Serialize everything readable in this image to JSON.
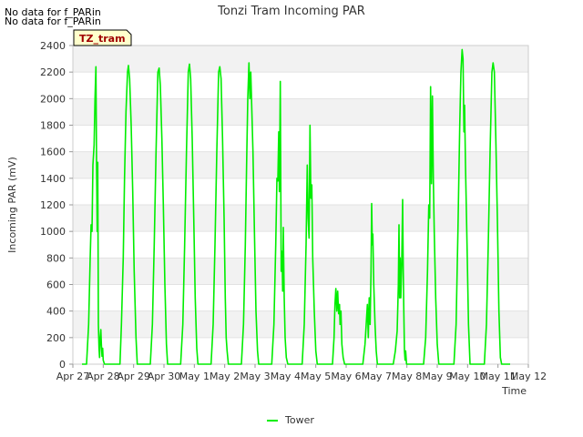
{
  "notices": [
    "No data for f_PARin",
    "No data for f_PARin"
  ],
  "site_badge": "TZ_tram",
  "chart_data": {
    "type": "line",
    "title": "Tonzi Tram Incoming PAR",
    "xlabel": "Time",
    "ylabel": "Incoming PAR (mV)",
    "ylim": [
      0,
      2400
    ],
    "yticks": [
      0,
      200,
      400,
      600,
      800,
      1000,
      1200,
      1400,
      1600,
      1800,
      2000,
      2200,
      2400
    ],
    "xlim": [
      0,
      15
    ],
    "xticks": [
      {
        "pos": 0,
        "label": "Apr 27"
      },
      {
        "pos": 1,
        "label": "Apr 28"
      },
      {
        "pos": 2,
        "label": "Apr 29"
      },
      {
        "pos": 3,
        "label": "Apr 30"
      },
      {
        "pos": 4,
        "label": "May 1"
      },
      {
        "pos": 5,
        "label": "May 2"
      },
      {
        "pos": 6,
        "label": "May 3"
      },
      {
        "pos": 7,
        "label": "May 4"
      },
      {
        "pos": 8,
        "label": "May 5"
      },
      {
        "pos": 9,
        "label": "May 6"
      },
      {
        "pos": 10,
        "label": "May 7"
      },
      {
        "pos": 11,
        "label": "May 8"
      },
      {
        "pos": 12,
        "label": "May 9"
      },
      {
        "pos": 13,
        "label": "May 10"
      },
      {
        "pos": 14,
        "label": "May 11"
      },
      {
        "pos": 15,
        "label": "May 12"
      }
    ],
    "grid": "horizontal bands",
    "legend_position": "bottom-center",
    "series": [
      {
        "name": "Tower",
        "color": "#00ee00",
        "points": [
          [
            0.3,
            0
          ],
          [
            0.45,
            0
          ],
          [
            0.52,
            300
          ],
          [
            0.57,
            800
          ],
          [
            0.6,
            1050
          ],
          [
            0.63,
            1000
          ],
          [
            0.66,
            1500
          ],
          [
            0.7,
            1650
          ],
          [
            0.73,
            2000
          ],
          [
            0.76,
            2240
          ],
          [
            0.78,
            1500
          ],
          [
            0.8,
            1000
          ],
          [
            0.82,
            1520
          ],
          [
            0.84,
            300
          ],
          [
            0.86,
            120
          ],
          [
            0.88,
            50
          ],
          [
            0.9,
            200
          ],
          [
            0.92,
            260
          ],
          [
            0.94,
            150
          ],
          [
            0.96,
            60
          ],
          [
            0.98,
            120
          ],
          [
            1.0,
            30
          ],
          [
            1.04,
            0
          ],
          [
            1.55,
            0
          ],
          [
            1.6,
            300
          ],
          [
            1.66,
            800
          ],
          [
            1.7,
            1400
          ],
          [
            1.75,
            1900
          ],
          [
            1.8,
            2200
          ],
          [
            1.83,
            2250
          ],
          [
            1.87,
            2150
          ],
          [
            1.92,
            1800
          ],
          [
            1.97,
            1300
          ],
          [
            2.02,
            700
          ],
          [
            2.08,
            200
          ],
          [
            2.12,
            0
          ],
          [
            2.55,
            0
          ],
          [
            2.62,
            300
          ],
          [
            2.68,
            900
          ],
          [
            2.74,
            1600
          ],
          [
            2.8,
            2200
          ],
          [
            2.84,
            2230
          ],
          [
            2.88,
            2100
          ],
          [
            2.93,
            1700
          ],
          [
            2.98,
            1200
          ],
          [
            3.03,
            600
          ],
          [
            3.08,
            150
          ],
          [
            3.12,
            0
          ],
          [
            3.55,
            0
          ],
          [
            3.62,
            300
          ],
          [
            3.68,
            900
          ],
          [
            3.74,
            1600
          ],
          [
            3.8,
            2200
          ],
          [
            3.84,
            2260
          ],
          [
            3.88,
            2150
          ],
          [
            3.93,
            1700
          ],
          [
            3.98,
            1100
          ],
          [
            4.03,
            500
          ],
          [
            4.08,
            120
          ],
          [
            4.12,
            0
          ],
          [
            4.55,
            0
          ],
          [
            4.62,
            300
          ],
          [
            4.68,
            900
          ],
          [
            4.74,
            1600
          ],
          [
            4.8,
            2200
          ],
          [
            4.84,
            2240
          ],
          [
            4.88,
            2150
          ],
          [
            4.93,
            1700
          ],
          [
            4.98,
            1100
          ],
          [
            5.02,
            500
          ],
          [
            5.05,
            200
          ],
          [
            5.08,
            100
          ],
          [
            5.12,
            0
          ],
          [
            5.55,
            0
          ],
          [
            5.62,
            300
          ],
          [
            5.68,
            900
          ],
          [
            5.72,
            1500
          ],
          [
            5.76,
            2000
          ],
          [
            5.8,
            2270
          ],
          [
            5.83,
            2000
          ],
          [
            5.86,
            2200
          ],
          [
            5.89,
            1950
          ],
          [
            5.93,
            1600
          ],
          [
            5.98,
            1000
          ],
          [
            6.03,
            400
          ],
          [
            6.08,
            100
          ],
          [
            6.12,
            0
          ],
          [
            6.55,
            0
          ],
          [
            6.62,
            300
          ],
          [
            6.68,
            900
          ],
          [
            6.72,
            1400
          ],
          [
            6.75,
            1380
          ],
          [
            6.78,
            1750
          ],
          [
            6.8,
            1300
          ],
          [
            6.83,
            2130
          ],
          [
            6.86,
            700
          ],
          [
            6.89,
            850
          ],
          [
            6.91,
            550
          ],
          [
            6.93,
            1030
          ],
          [
            6.96,
            500
          ],
          [
            6.99,
            200
          ],
          [
            7.03,
            50
          ],
          [
            7.08,
            0
          ],
          [
            7.55,
            0
          ],
          [
            7.62,
            300
          ],
          [
            7.68,
            900
          ],
          [
            7.72,
            1500
          ],
          [
            7.75,
            1100
          ],
          [
            7.78,
            950
          ],
          [
            7.81,
            1800
          ],
          [
            7.84,
            1250
          ],
          [
            7.87,
            1350
          ],
          [
            7.9,
            800
          ],
          [
            7.95,
            400
          ],
          [
            8.0,
            100
          ],
          [
            8.05,
            0
          ],
          [
            8.55,
            0
          ],
          [
            8.6,
            200
          ],
          [
            8.63,
            450
          ],
          [
            8.66,
            570
          ],
          [
            8.69,
            400
          ],
          [
            8.72,
            550
          ],
          [
            8.75,
            380
          ],
          [
            8.78,
            450
          ],
          [
            8.8,
            300
          ],
          [
            8.83,
            400
          ],
          [
            8.86,
            150
          ],
          [
            8.9,
            50
          ],
          [
            8.95,
            0
          ],
          [
            9.55,
            0
          ],
          [
            9.62,
            150
          ],
          [
            9.66,
            300
          ],
          [
            9.7,
            450
          ],
          [
            9.73,
            200
          ],
          [
            9.76,
            500
          ],
          [
            9.79,
            300
          ],
          [
            9.82,
            700
          ],
          [
            9.84,
            1210
          ],
          [
            9.86,
            900
          ],
          [
            9.88,
            980
          ],
          [
            9.91,
            600
          ],
          [
            9.95,
            300
          ],
          [
            9.99,
            100
          ],
          [
            10.03,
            0
          ],
          [
            10.55,
            0
          ],
          [
            10.62,
            100
          ],
          [
            10.68,
            250
          ],
          [
            10.72,
            600
          ],
          [
            10.74,
            1050
          ],
          [
            10.76,
            500
          ],
          [
            10.78,
            800
          ],
          [
            10.8,
            500
          ],
          [
            10.83,
            750
          ],
          [
            10.86,
            1240
          ],
          [
            10.88,
            700
          ],
          [
            10.9,
            400
          ],
          [
            10.92,
            100
          ],
          [
            10.94,
            30
          ],
          [
            10.96,
            100
          ],
          [
            10.99,
            0
          ],
          [
            11.55,
            0
          ],
          [
            11.62,
            200
          ],
          [
            11.68,
            700
          ],
          [
            11.72,
            1200
          ],
          [
            11.75,
            1100
          ],
          [
            11.78,
            2090
          ],
          [
            11.81,
            1360
          ],
          [
            11.84,
            2020
          ],
          [
            11.87,
            1400
          ],
          [
            11.9,
            1000
          ],
          [
            11.95,
            500
          ],
          [
            12.0,
            150
          ],
          [
            12.05,
            0
          ],
          [
            12.55,
            0
          ],
          [
            12.62,
            300
          ],
          [
            12.68,
            1000
          ],
          [
            12.74,
            1800
          ],
          [
            12.78,
            2200
          ],
          [
            12.82,
            2370
          ],
          [
            12.85,
            2300
          ],
          [
            12.88,
            1750
          ],
          [
            12.9,
            1950
          ],
          [
            12.93,
            1500
          ],
          [
            12.98,
            900
          ],
          [
            13.03,
            300
          ],
          [
            13.08,
            0
          ],
          [
            13.55,
            0
          ],
          [
            13.62,
            300
          ],
          [
            13.68,
            900
          ],
          [
            13.74,
            1600
          ],
          [
            13.8,
            2200
          ],
          [
            13.84,
            2270
          ],
          [
            13.88,
            2200
          ],
          [
            13.93,
            1700
          ],
          [
            13.98,
            1100
          ],
          [
            14.03,
            400
          ],
          [
            14.08,
            50
          ],
          [
            14.12,
            0
          ],
          [
            14.4,
            0
          ]
        ]
      }
    ]
  }
}
